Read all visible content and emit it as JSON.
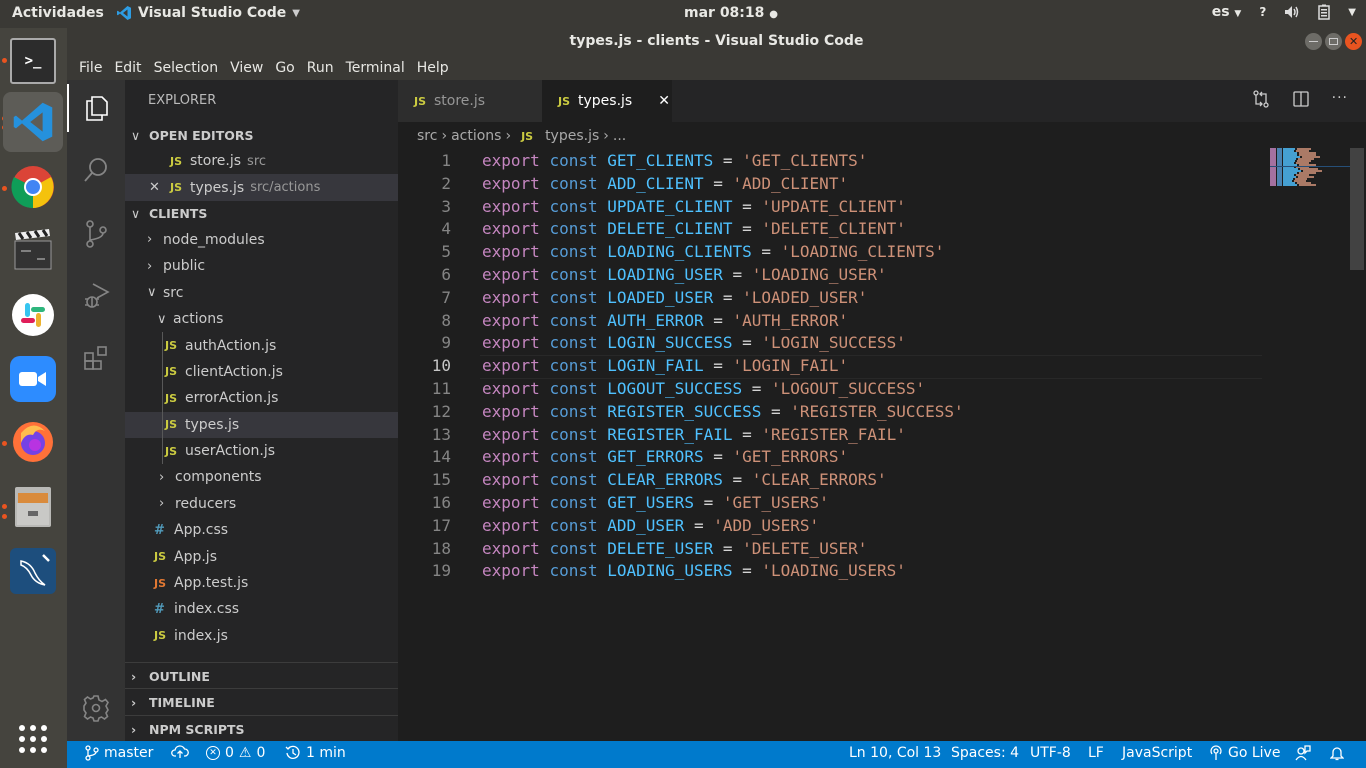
{
  "topbar": {
    "activities": "Actividades",
    "app_name": "Visual Studio Code",
    "clock": "mar 08:18",
    "lang": "es",
    "icons": [
      "help-icon",
      "volume-icon",
      "battery-icon",
      "system-menu-chevron-icon"
    ]
  },
  "dock": {
    "items": [
      {
        "name": "terminal",
        "running": true
      },
      {
        "name": "vscode",
        "running": true,
        "active": true
      },
      {
        "name": "chrome",
        "running": true
      },
      {
        "name": "clapperboard-video-editor",
        "running": false
      },
      {
        "name": "slack",
        "running": false
      },
      {
        "name": "zoom",
        "running": false
      },
      {
        "name": "firefox",
        "running": true
      },
      {
        "name": "file-cabinet",
        "running": true
      },
      {
        "name": "mysql-workbench",
        "running": false
      }
    ],
    "show_apps": "show-applications"
  },
  "window": {
    "title": "types.js - clients - Visual Studio Code"
  },
  "menu": [
    "File",
    "Edit",
    "Selection",
    "View",
    "Go",
    "Run",
    "Terminal",
    "Help"
  ],
  "sidebar": {
    "title": "EXPLORER",
    "open_editors": {
      "label": "OPEN EDITORS",
      "items": [
        {
          "name": "store.js",
          "path": "src"
        },
        {
          "name": "types.js",
          "path": "src/actions"
        }
      ]
    },
    "workspace": {
      "label": "CLIENTS",
      "tree": [
        {
          "name": "node_modules",
          "type": "folder",
          "expanded": false
        },
        {
          "name": "public",
          "type": "folder",
          "expanded": false
        },
        {
          "name": "src",
          "type": "folder",
          "expanded": true
        },
        {
          "name": "actions",
          "type": "folder",
          "expanded": true
        },
        {
          "name": "authAction.js",
          "type": "js"
        },
        {
          "name": "clientAction.js",
          "type": "js"
        },
        {
          "name": "errorAction.js",
          "type": "js"
        },
        {
          "name": "types.js",
          "type": "js",
          "selected": true
        },
        {
          "name": "userAction.js",
          "type": "js"
        },
        {
          "name": "components",
          "type": "folder",
          "expanded": false
        },
        {
          "name": "reducers",
          "type": "folder",
          "expanded": false
        },
        {
          "name": "App.css",
          "type": "css"
        },
        {
          "name": "App.js",
          "type": "js"
        },
        {
          "name": "App.test.js",
          "type": "test"
        },
        {
          "name": "index.css",
          "type": "css"
        },
        {
          "name": "index.js",
          "type": "js"
        }
      ]
    },
    "bottom_sections": [
      "OUTLINE",
      "TIMELINE",
      "NPM SCRIPTS"
    ]
  },
  "tabs": [
    {
      "label": "store.js",
      "active": false
    },
    {
      "label": "types.js",
      "active": true
    }
  ],
  "breadcrumb": [
    "src",
    "actions",
    "types.js",
    "..."
  ],
  "code": {
    "current_line": 10,
    "lines": [
      {
        "n": "1",
        "name": "GET_CLIENTS",
        "value": "'GET_CLIENTS'"
      },
      {
        "n": "2",
        "name": "ADD_CLIENT",
        "value": "'ADD_CLIENT'"
      },
      {
        "n": "3",
        "name": "UPDATE_CLIENT",
        "value": "'UPDATE_CLIENT'"
      },
      {
        "n": "4",
        "name": "DELETE_CLIENT",
        "value": "'DELETE_CLIENT'"
      },
      {
        "n": "5",
        "name": "LOADING_CLIENTS",
        "value": "'LOADING_CLIENTS'"
      },
      {
        "n": "6",
        "name": "LOADING_USER",
        "value": "'LOADING_USER'"
      },
      {
        "n": "7",
        "name": "LOADED_USER",
        "value": "'LOADED_USER'"
      },
      {
        "n": "8",
        "name": "AUTH_ERROR",
        "value": "'AUTH_ERROR'"
      },
      {
        "n": "9",
        "name": "LOGIN_SUCCESS",
        "value": "'LOGIN_SUCCESS'"
      },
      {
        "n": "10",
        "name": "LOGIN_FAIL",
        "value": "'LOGIN_FAIL'"
      },
      {
        "n": "11",
        "name": "LOGOUT_SUCCESS",
        "value": "'LOGOUT_SUCCESS'"
      },
      {
        "n": "12",
        "name": "REGISTER_SUCCESS",
        "value": "'REGISTER_SUCCESS'"
      },
      {
        "n": "13",
        "name": "REGISTER_FAIL",
        "value": "'REGISTER_FAIL'"
      },
      {
        "n": "14",
        "name": "GET_ERRORS",
        "value": "'GET_ERRORS'"
      },
      {
        "n": "15",
        "name": "CLEAR_ERRORS",
        "value": "'CLEAR_ERRORS'"
      },
      {
        "n": "16",
        "name": "GET_USERS",
        "value": "'GET_USERS'"
      },
      {
        "n": "17",
        "name": "ADD_USER",
        "value": "'ADD_USERS'"
      },
      {
        "n": "18",
        "name": "DELETE_USER",
        "value": "'DELETE_USER'"
      },
      {
        "n": "19",
        "name": "LOADING_USERS",
        "value": "'LOADING_USERS'"
      }
    ],
    "kw_export": "export",
    "kw_const": "const",
    "op": "="
  },
  "status": {
    "branch": "master",
    "errors": "0",
    "warnings": "0",
    "timer": "1 min",
    "position": "Ln 10, Col 13",
    "spaces": "Spaces: 4",
    "encoding": "UTF-8",
    "eol": "LF",
    "language": "JavaScript",
    "go_live": "Go Live"
  },
  "colors": {
    "status_bar": "#007acc",
    "keyword_export": "#c586c0",
    "keyword_const": "#569cd6",
    "identifier": "#4fc1ff",
    "string": "#ce9178",
    "js_icon": "#cbcb41"
  }
}
